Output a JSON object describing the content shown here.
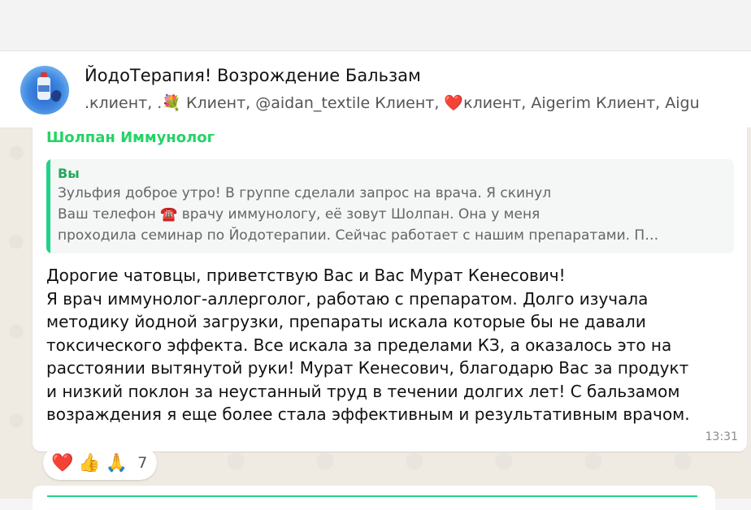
{
  "chat": {
    "title": "ЙодоТерапия! Возрождение Бальзам",
    "members": ".клиент, .💐 Клиент, @aidan_textile Клиент, ❤️клиент, Aigerim Клиент, Aigu",
    "avatar_icon": "iodine-bottle-avatar"
  },
  "message": {
    "sender": "Шолпан Иммунолог",
    "quote": {
      "author": "Вы",
      "lines": [
        "Зульфия доброе утро! В группе сделали запрос на врача. Я скинул",
        "Ваш телефон ☎️ врачу иммунологу, её зовут Шолпан. Она у меня",
        "проходила семинар по Йодотерапии. Сейчас работает с нашим препаратами. П…"
      ]
    },
    "lines": [
      "Дорогие чатовцы, приветствую Вас и Вас Мурат Кенесович!",
      "Я врач иммунолог-аллерголог, работаю с препаратом. Долго изучала",
      "методику йодной загрузки, препараты искала которые бы не давали",
      "токсического эффекта. Все искала за пределами КЗ, а оказалось это на",
      "расстоянии вытянутой руки! Мурат Кенесович, благодарю Вас за продукт",
      "и низкий поклон за неустанный труд в течении долгих лет! С бальзамом",
      "возраждения я еще более стала эффективным и результативным врачом."
    ],
    "time": "13:31",
    "reactions": {
      "emojis": [
        "❤️",
        "👍",
        "🙏"
      ],
      "count": "7"
    }
  },
  "colors": {
    "sender": "#25d366",
    "quote_bar": "#1ed48a",
    "chat_background": "#efeae2"
  }
}
